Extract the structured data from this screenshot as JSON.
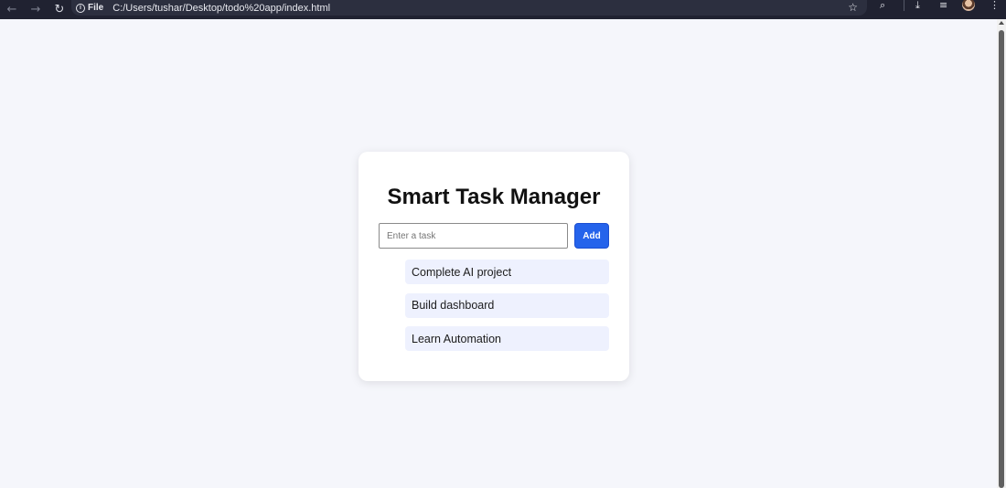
{
  "browser": {
    "back_icon": "←",
    "forward_icon": "→",
    "reload_icon": "↻",
    "chip_label": "File",
    "url": "C:/Users/tushar/Desktop/todo%20app/index.html",
    "star_icon": "☆"
  },
  "app": {
    "title": "Smart Task Manager",
    "input_placeholder": "Enter a task",
    "input_value": "",
    "add_label": "Add",
    "tasks": [
      {
        "label": "Complete AI project"
      },
      {
        "label": "Build dashboard"
      },
      {
        "label": "Learn Automation"
      }
    ]
  },
  "colors": {
    "accent": "#2563eb",
    "page_bg": "#f5f6fb",
    "task_bg": "#eef1fe",
    "chrome_bg": "#202231"
  }
}
